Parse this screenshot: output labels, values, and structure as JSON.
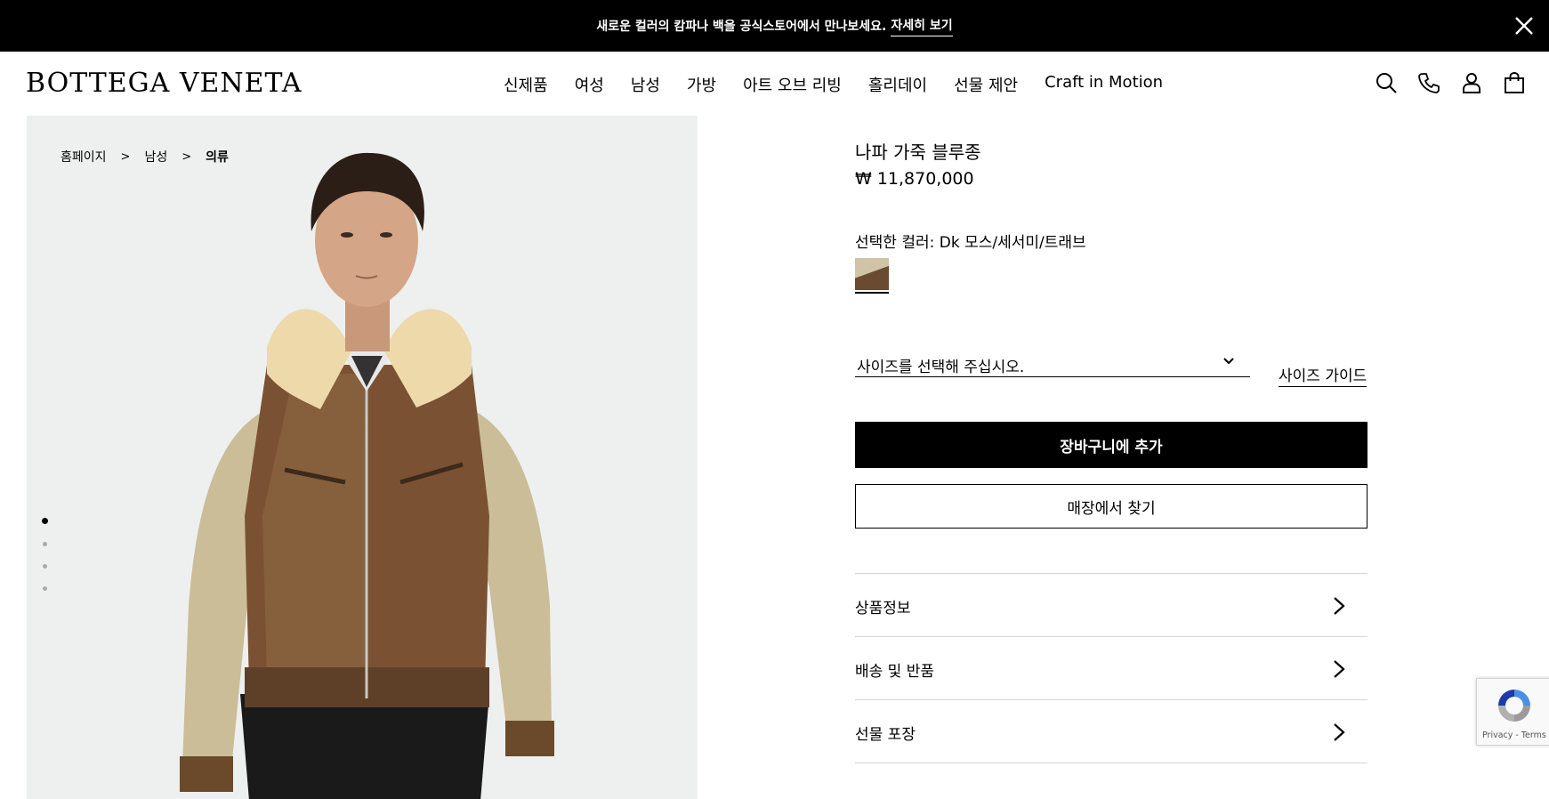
{
  "promo": {
    "message": "새로운 컬러의 캄파나 백을 공식스토어에서 만나보세요.",
    "link": "자세히 보기"
  },
  "header": {
    "logo": "BOTTEGA VENETA",
    "nav": [
      "신제품",
      "여성",
      "남성",
      "가방",
      "아트 오브 리빙",
      "홀리데이",
      "선물 제안",
      "Craft in Motion"
    ],
    "icons": [
      "search-icon",
      "phone-icon",
      "account-icon",
      "bag-icon"
    ]
  },
  "breadcrumb": [
    "홈페이지",
    "남성",
    "의류"
  ],
  "breadcrumb_separator": ">",
  "gallery": {
    "slide_count": 4,
    "active_slide": 1
  },
  "product": {
    "name": "나파 가죽 블루종",
    "price": "₩ 11,870,000",
    "color_label": "선택한 컬러: Dk 모스/세서미/트래브",
    "size_placeholder": "사이즈를 선택해 주십시오.",
    "size_guide": "사이즈 가이드",
    "add_to_cart": "장바구니에 추가",
    "find_in_store": "매장에서 찾기"
  },
  "accordion": [
    {
      "label": "상품정보"
    },
    {
      "label": "배송 및 반품"
    },
    {
      "label": "선물 포장"
    }
  ],
  "recaptcha": {
    "text": "Privacy - Terms"
  },
  "colors": {
    "promo_bg": "#000000",
    "gallery_bg": "#eef0ef",
    "cart_button": "#000000"
  }
}
